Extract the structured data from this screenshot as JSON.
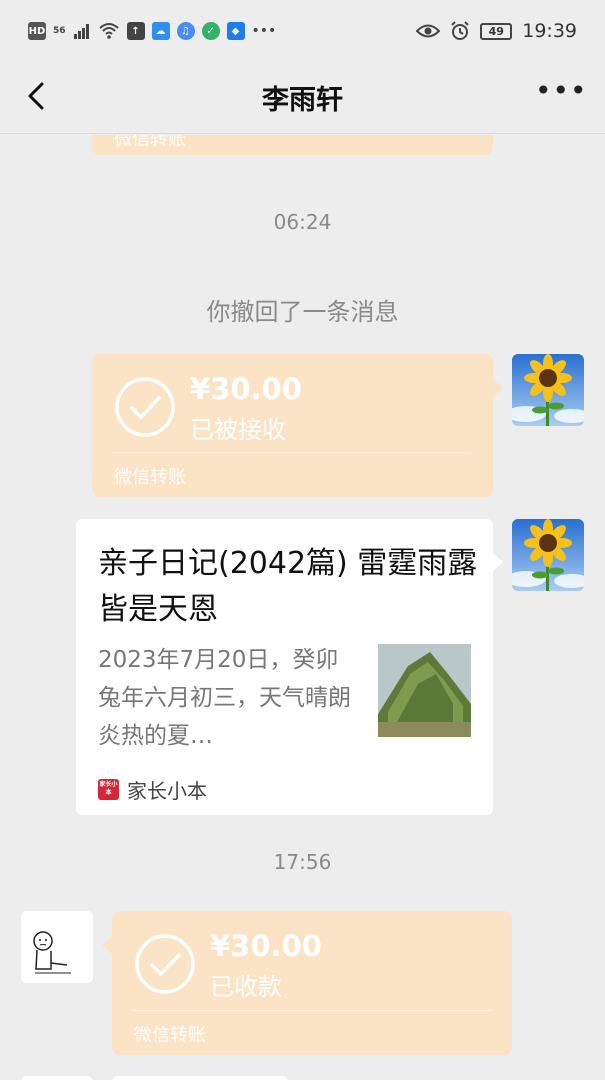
{
  "status_bar": {
    "left_badges": [
      "HD",
      "56"
    ],
    "battery": "49",
    "time": "19:39"
  },
  "nav": {
    "title": "李雨轩",
    "more": "•••"
  },
  "messages": {
    "top_partial_footer": "微信转账",
    "time_1": "06:24",
    "recalled": "你撤回了一条消息",
    "transfer_1": {
      "amount": "¥30.00",
      "status": "已被接收",
      "footer": "微信转账"
    },
    "link_card": {
      "title": "亲子日记(2042篇) 雷霆雨露皆是天恩",
      "description": "2023年7月20日，癸卯兔年六月初三，天气晴朗炎热的夏…",
      "source_logo_text": "家长小本",
      "source": "家长小本"
    },
    "time_2": "17:56",
    "transfer_2": {
      "amount": "¥30.00",
      "status": "已收款",
      "footer": "微信转账"
    }
  },
  "colors": {
    "background": "#ededed",
    "transfer_bubble": "#fbe3c6",
    "card": "#ffffff",
    "meta_text": "#8a8a8a",
    "source_logo": "#d6253a"
  }
}
